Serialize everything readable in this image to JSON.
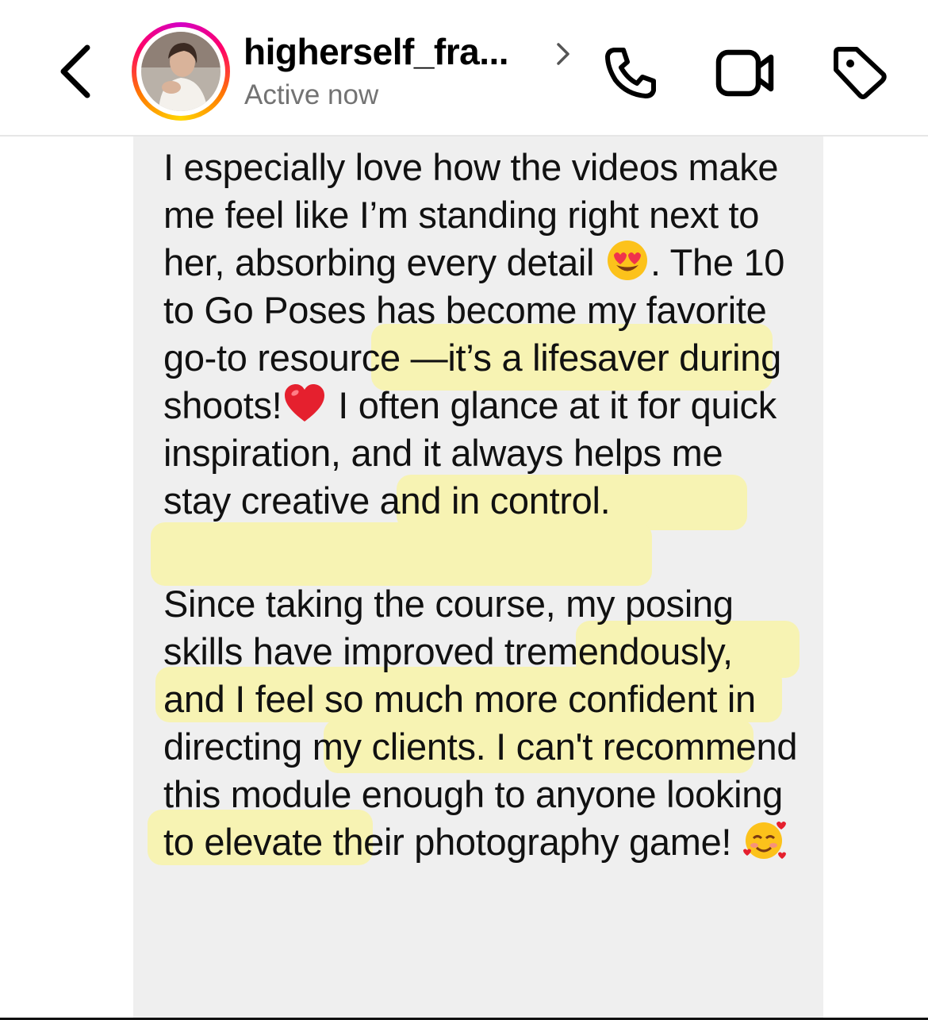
{
  "header": {
    "username": "higherself_fra...",
    "status": "Active now"
  },
  "colors": {
    "highlight": "#f7f3b3",
    "bubble": "#efefef",
    "status_text": "#737373"
  },
  "icons": {
    "back": "chevron-left-icon",
    "profile": "chevron-right-icon",
    "call": "phone-icon",
    "video": "video-camera-icon",
    "tag": "tag-icon"
  },
  "message": {
    "paragraph1": {
      "part1": "I especially love how the videos make me feel like I’m standing right next to her, absorbing every detail ",
      "part2": ". The 10 to Go Poses has become my ",
      "highlight1": "favorite go-to resource",
      "part3": " —it’s a lifesaver during shoots!",
      "part4": " I often glance at it for quick inspiration, an",
      "highlight2": "d it always helps me stay creative and in control."
    },
    "paragraph2": {
      "part1": "Since taking the course, ",
      "highlight1": "my posing skills have improved tremendously,",
      "part2": " and I feel ",
      "highlight2": "so much more confident",
      "part3": " in directing my clients. I can't ",
      "highlight3": "recommend",
      "part4": " this module enough to anyone looking to elevate their photography game! "
    },
    "emojis": [
      "heart-eyes-emoji",
      "red-heart-emoji",
      "smiling-face-with-hearts-emoji"
    ]
  }
}
